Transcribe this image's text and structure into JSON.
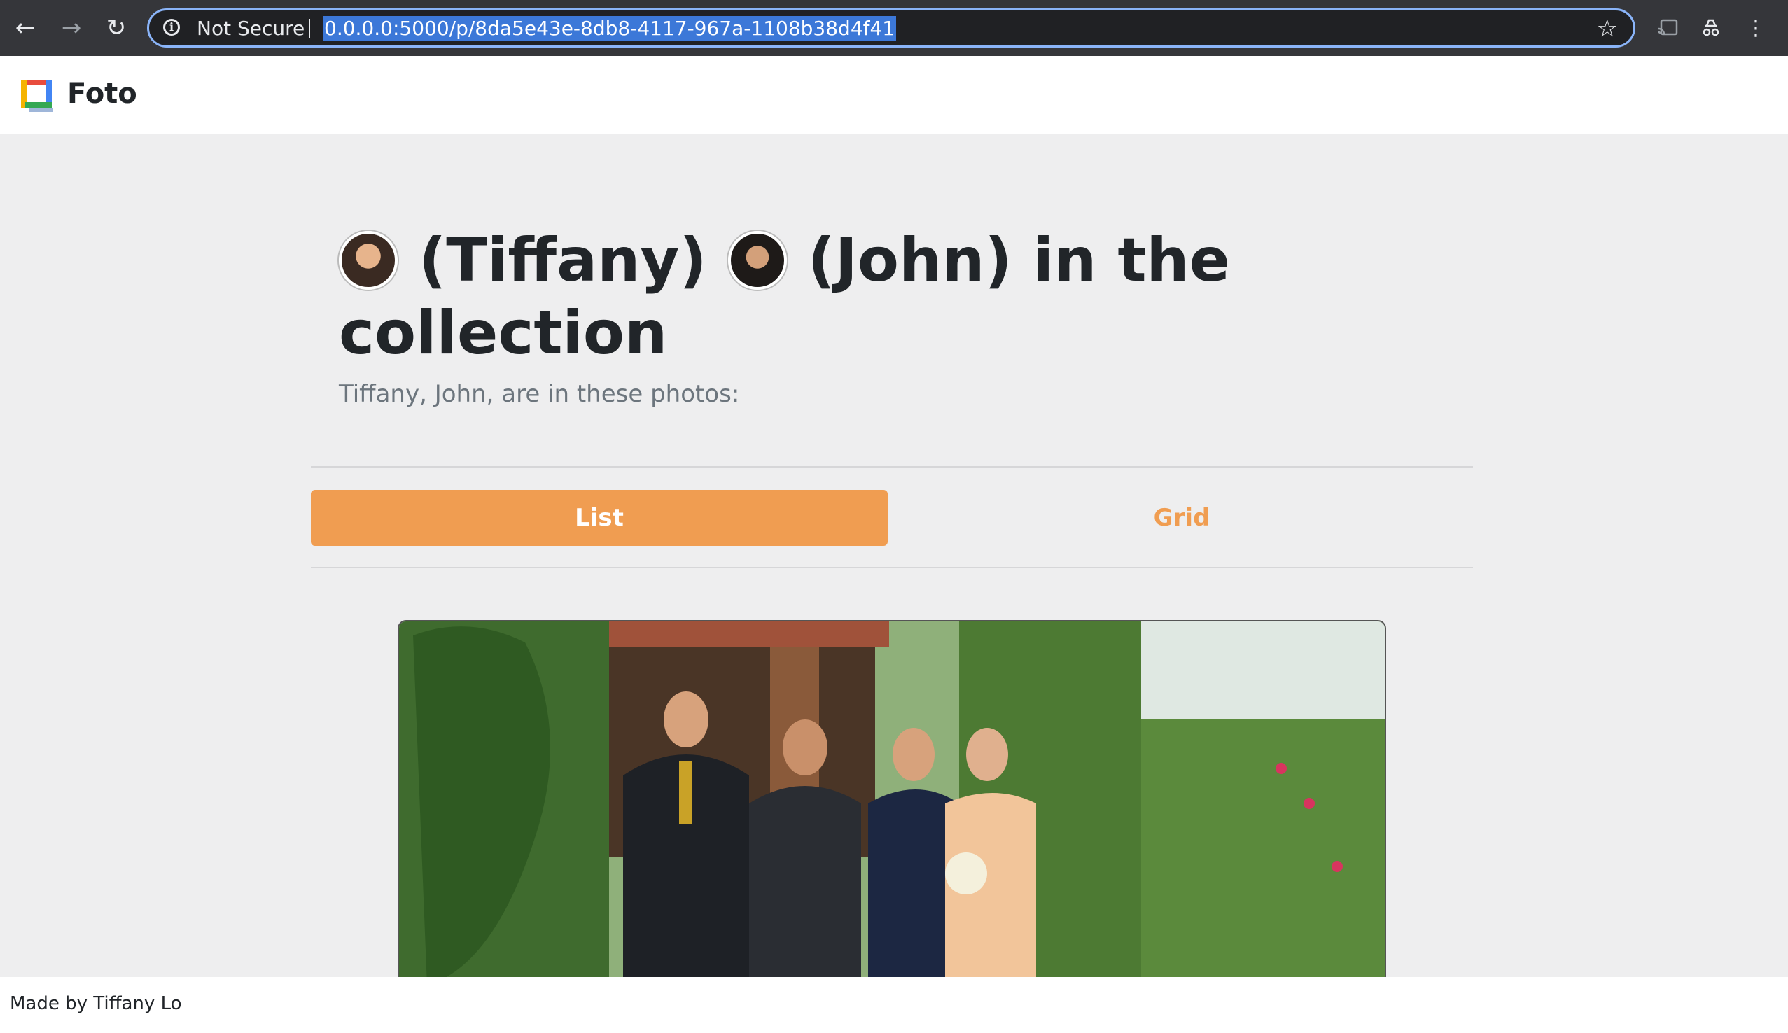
{
  "browser": {
    "security_label": "Not Secure",
    "url": "0.0.0.0:5000/p/8da5e43e-8db8-4117-967a-1108b38d4f41",
    "icons": [
      "back-arrow-icon",
      "forward-arrow-icon",
      "reload-icon",
      "info-icon",
      "star-icon",
      "cast-icon",
      "incognito-icon",
      "menu-dots-icon"
    ]
  },
  "header": {
    "brand": "Foto",
    "logo_colors": [
      "#e84c3d",
      "#f5b400",
      "#34a853",
      "#4285f4"
    ]
  },
  "main": {
    "title_part1": "(Tiffany)",
    "title_part2": "(John) in the collection",
    "subtitle": "Tiffany, John, are in these photos:",
    "people": [
      "Tiffany",
      "John"
    ],
    "view_tabs": {
      "list": "List",
      "grid": "Grid",
      "selected": "List"
    },
    "accent_color": "#f09d51"
  },
  "footer": {
    "text": "Made by Tiffany Lo"
  }
}
